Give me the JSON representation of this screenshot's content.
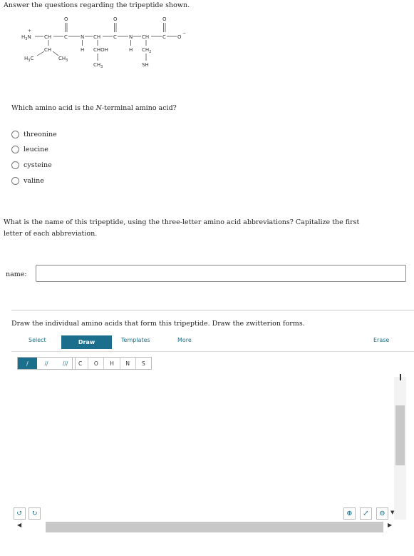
{
  "intro": "Answer the questions regarding the tripeptide shown.",
  "structure": {
    "labels": {
      "nh3": "H3N",
      "plus": "+",
      "ch": "CH",
      "c": "C",
      "n": "N",
      "o": "O",
      "o_minus": "O",
      "minus": "−",
      "h": "H",
      "chch3": "CH",
      "h3c": "H3C",
      "ch3": "CH3",
      "choh": "CHOH",
      "ch2": "CH2",
      "sh": "SH"
    }
  },
  "q1": {
    "prompt_pre": "Which amino acid is the ",
    "prompt_em": "N",
    "prompt_post": "-terminal amino acid?",
    "options": [
      "threonine",
      "leucine",
      "cysteine",
      "valine"
    ]
  },
  "q2": {
    "prompt": "What is the name of this tripeptide, using the three-letter amino acid abbreviations? Capitalize the first letter of each abbreviation.",
    "label": "name:",
    "value": "",
    "placeholder": ""
  },
  "q3": {
    "prompt": "Draw the individual amino acids that form this tripeptide. Draw the zwitterion forms."
  },
  "sketcher": {
    "tabs": {
      "select": "Select",
      "draw": "Draw",
      "templates": "Templates",
      "more": "More",
      "erase": "Erase"
    },
    "bonds": [
      "single-bond-icon",
      "double-bond-icon",
      "triple-bond-icon"
    ],
    "atoms": [
      "C",
      "O",
      "H",
      "N",
      "S"
    ],
    "icons": {
      "undo": "undo-icon",
      "redo": "redo-icon",
      "zoom_in": "zoom-in-icon",
      "zoom_fit": "zoom-fit-icon",
      "zoom_out": "zoom-out-icon"
    }
  }
}
